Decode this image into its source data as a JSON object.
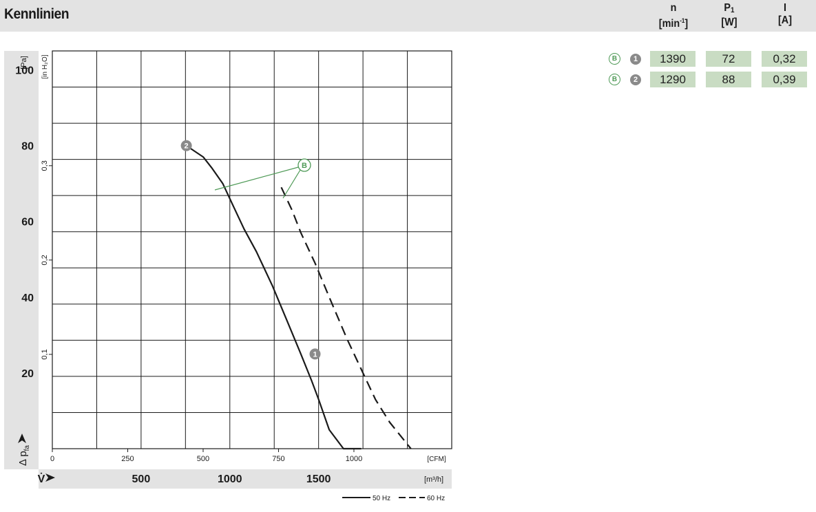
{
  "title": "Kennlinien",
  "columns": [
    {
      "symbol": "n",
      "unit": "[min",
      "unit_sup": "-1",
      "unit_end": "]"
    },
    {
      "symbol": "P",
      "symbol_sub": "1",
      "unit": "[W]"
    },
    {
      "symbol": "I",
      "unit": "[A]"
    }
  ],
  "operating_points": [
    {
      "curve": "B",
      "point": "1",
      "n": "1390",
      "p1": "72",
      "i": "0,32"
    },
    {
      "curve": "B",
      "point": "2",
      "n": "1290",
      "p1": "88",
      "i": "0,39"
    }
  ],
  "colors": {
    "band": "#e3e3e3",
    "cell": "#c9dcc3",
    "curve_label": "#4f9a57",
    "point_marker": "#8a8a8a",
    "line": "#1a1a1a"
  },
  "chart_data": {
    "type": "line",
    "y_axis": {
      "unit": "[Pa]",
      "range": [
        0,
        105
      ],
      "ticks": [
        20,
        40,
        60,
        80,
        100
      ],
      "secondary_unit": "[in H₂O]",
      "secondary_ticks": [
        "0,1",
        "0,2",
        "0,3"
      ],
      "secondary_tick_values_pa": [
        24.9,
        49.8,
        74.7
      ],
      "label": "Δ p",
      "label_sub": "fa"
    },
    "x_axis": {
      "unit": "[m³/h]",
      "range": [
        0,
        2250
      ],
      "ticks": [
        500,
        1000,
        1500
      ],
      "secondary_unit": "[CFM]",
      "secondary_ticks": [
        "0",
        "250",
        "500",
        "750",
        "1000"
      ],
      "secondary_tick_values_m3h": [
        0,
        424.75,
        849.5,
        1274.25,
        1699
      ],
      "label": "V̇"
    },
    "grid": true,
    "series": [
      {
        "name": "50 Hz",
        "style": "solid",
        "x": [
          755,
          850,
          900,
          960,
          1020,
          1080,
          1150,
          1240,
          1320,
          1400,
          1460,
          1500,
          1560,
          1640,
          1740
        ],
        "y": [
          80,
          77,
          74,
          70,
          64,
          58,
          52,
          43,
          34,
          25,
          18,
          13,
          5,
          0,
          0
        ],
        "points": [
          {
            "label": "2",
            "x": 755,
            "y": 80
          },
          {
            "label": "1",
            "x": 1480,
            "y": 25
          }
        ]
      },
      {
        "name": "60 Hz",
        "style": "dashed",
        "x": [
          1290,
          1350,
          1400,
          1480,
          1560,
          1660,
          1740,
          1820,
          1900,
          2020
        ],
        "y": [
          69,
          63,
          57,
          49,
          40,
          29,
          21,
          13,
          7,
          0
        ]
      }
    ],
    "annotations": [
      {
        "text": "B"
      }
    ],
    "legend": [
      {
        "text": "50 Hz",
        "style": "solid"
      },
      {
        "text": "60 Hz",
        "style": "dashed"
      }
    ]
  }
}
